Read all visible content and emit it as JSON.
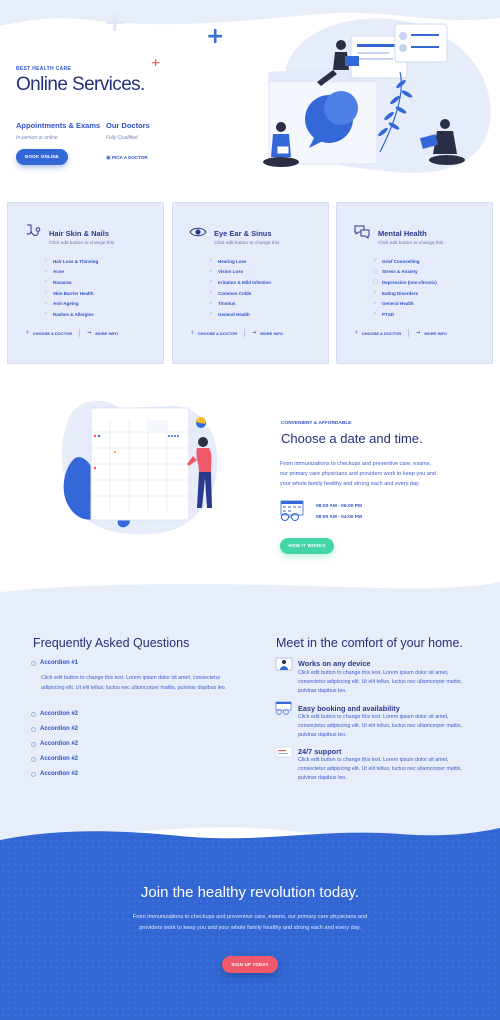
{
  "hero": {
    "eyebrow": "BEST HEALTH CARE",
    "title": "Online Services.",
    "col1_title": "Appointments & Exams",
    "col1_sub": "In-person or online",
    "col2_title": "Our Doctors",
    "col2_sub": "Fully Qualified",
    "book_button": "BOOK ONLINE",
    "pick_link": "PICK A DOCTOR"
  },
  "cards": [
    {
      "icon": "stethoscope-icon",
      "title": "Hair Skin & Nails",
      "sub": "Click edit button to change this",
      "items": [
        "Hair Loss & Thinning",
        "Acne",
        "Rosacea",
        "Skin Barrier Health",
        "Anti-Ageing",
        "Rashes & Allergies"
      ],
      "choose": "CHOOSE A DOCTOR",
      "more": "MORE INFO"
    },
    {
      "icon": "eye-icon",
      "title": "Eye Ear & Sinus",
      "sub": "Click edit button to change this",
      "items": [
        "Hearing Loss",
        "Vision Loss",
        "Irritation & Mild Infection",
        "Common Colds",
        "Tinnitus",
        "General Health"
      ],
      "choose": "CHOOSE A DOCTOR",
      "more": "MORE INFO"
    },
    {
      "icon": "chat-bubbles-icon",
      "title": "Mental Health",
      "sub": "Click edit button to change this",
      "items": [
        "Grief Counselling",
        "Stress & Anxiety",
        "Depression (non-chronic)",
        "Eating Disorders",
        "General Health",
        "PTSD"
      ],
      "choose": "CHOOSE A DOCTOR",
      "more": "MORE INFO"
    }
  ],
  "booking": {
    "eyebrow": "CONVENIENT & AFFORDABLE",
    "title": "Choose a date and time.",
    "text": "From immunizations to checkups and  preventive care, exams, our primary care physicians and providers work to keep you and your whole family healthy and strong each and every day.",
    "time1": "08:00 AM - 06:00 PM",
    "time2": "08:00 AM - 04:00 PM",
    "button": "HOW IT WORKS"
  },
  "faq": {
    "title": "Frequently Asked Questions",
    "open_title": "Accordion #1",
    "open_body": "Click edit button to change this text. Lorem ipsum dolor sit amet, consectetur adipiscing elit. Ut elit tellus, luctus nec ullamcorper mattis, pulvinar dapibus leo.",
    "closed": [
      "Accordion #2",
      "Accordion #2",
      "Accordion #2",
      "Accordion #2",
      "Accordion #2"
    ]
  },
  "meet": {
    "title": "Meet in the comfort of your home.",
    "features": [
      {
        "icon": "doctor-screen-icon",
        "title": "Works on any device",
        "body": "Click edit button to change this text. Lorem ipsum dolor sit amet, consectetur adipiscing elit. Ut elit tellus, luctus nec ullamcorper mattis, pulvinar dapibus leo."
      },
      {
        "icon": "calendar-glasses-icon",
        "title": "Easy booking and availability",
        "body": "Click edit button to change this text. Lorem ipsum dolor sit amet, consectetur adipiscing elit. Ut elit tellus, luctus nec ullamcorper mattis, pulvinar dapibus leo."
      },
      {
        "icon": "support-chat-icon",
        "title": "24/7 support",
        "body": "Click edit button to change this text. Lorem ipsum dolor sit amet, consectetur adipiscing elit. Ut elit tellus, luctus nec ullamcorper mattis, pulvinar dapibus leo."
      }
    ]
  },
  "footer": {
    "title": "Join the healthy revolution today.",
    "text": "From immunizations to checkups and  preventive care,  exams, our primary care physicians and providers work to keep you and your whole family healthy and strong each and every day.",
    "button": "SIGN UP TODAY"
  },
  "colors": {
    "primary": "#3468d8",
    "navy": "#24307a",
    "card_bg": "#e6ecf9",
    "section_bg": "#e8eef9",
    "accent_green": "#44d6a9",
    "accent_red": "#f0596a"
  }
}
